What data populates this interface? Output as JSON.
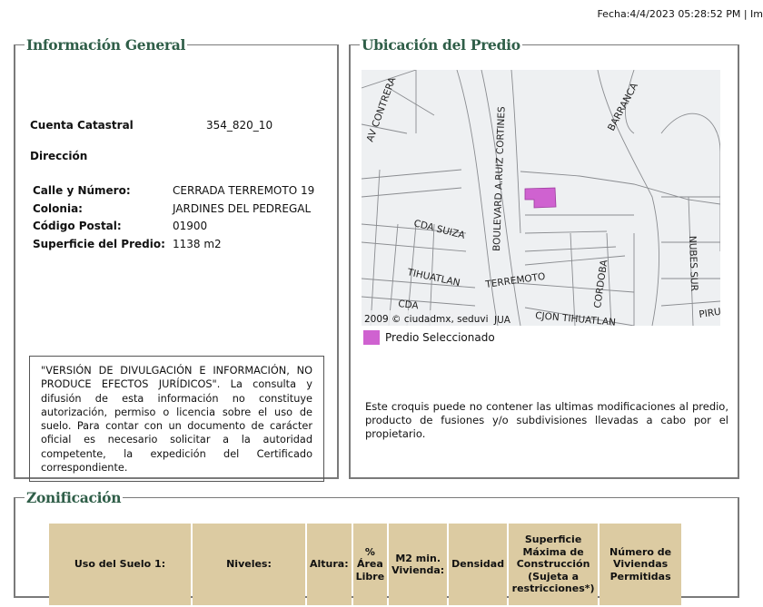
{
  "header": {
    "fecha": "Fecha:4/4/2023 05:28:52 PM | Im"
  },
  "general": {
    "title": "Información General",
    "cuenta_label": "Cuenta Catastral",
    "cuenta_value": "354_820_10",
    "direccion_label": "Dirección",
    "fields": [
      {
        "label": "Calle y Número:",
        "value": "CERRADA TERREMOTO 19"
      },
      {
        "label": "Colonia:",
        "value": "JARDINES DEL PEDREGAL"
      },
      {
        "label": "Código Postal:",
        "value": "01900"
      },
      {
        "label": "Superficie del Predio:",
        "value": "1138 m2"
      }
    ],
    "disclaimer": "\"VERSIÓN DE DIVULGACIÓN E INFORMACIÓN, NO PRODUCE EFECTOS JURÍDICOS\". La consulta y difusión de esta información no constituye autorización, permiso o licencia sobre el uso de suelo. Para contar con un documento de carácter oficial es necesario solicitar a la autoridad competente, la expedición del Certificado correspondiente."
  },
  "ubicacion": {
    "title": "Ubicación del Predio",
    "map_labels": [
      "AV CONTRERA",
      "BOULEVARD A.RUIZ CORTINES",
      "BARRANCA",
      "CDA SUIZA",
      "TIHUATLAN",
      "TERREMOTO",
      "CORDOBA",
      "NUBES SUR",
      "CJON TIHUATLAN",
      "PIRU",
      "CDA",
      "JUA"
    ],
    "copyright": "2009 © ciudadmx, seduvi",
    "legend_label": "Predio Seleccionado",
    "highlight_color": "#cf62d0",
    "note": "Este croquis puede no contener las ultimas modificaciones al predio, producto de fusiones y/o subdivisiones llevadas a cabo por el propietario."
  },
  "zonificacion": {
    "title": "Zonificación",
    "columns": [
      "Uso del Suelo 1:",
      "Niveles:",
      "Altura:",
      "% Área Libre",
      "M2 min. Vivienda:",
      "Densidad",
      "Superficie Máxima de Construcción (Sujeta a restricciones*)",
      "Número de Viviendas Permitidas"
    ]
  }
}
